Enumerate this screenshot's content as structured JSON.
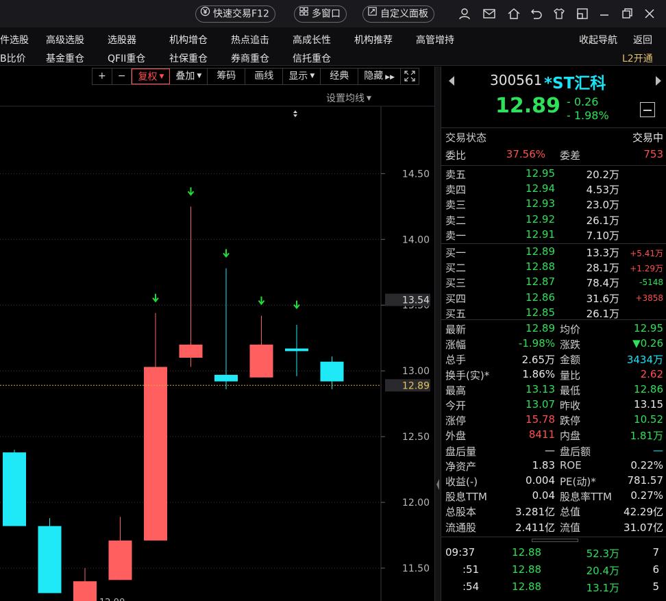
{
  "titlebar": {
    "quick_trade": "快速交易F12",
    "multi_window": "多窗口",
    "custom_panel": "自定义面板"
  },
  "nav": {
    "row1": [
      "件选股",
      "高级选股",
      "选股器",
      "机构增仓",
      "热点追击",
      "高成长性",
      "机构推荐",
      "高管增持"
    ],
    "row2": [
      "B比价",
      "基金重仓",
      "QFII重仓",
      "社保重仓",
      "券商重仓",
      "信托重仓"
    ],
    "collapse": "收起导航",
    "back": "返回",
    "l2": "L2开通"
  },
  "toolbar": {
    "plus": "+",
    "minus": "−",
    "restore": "复权",
    "overlay": "叠加",
    "chips": "筹码",
    "draw": "画线",
    "display": "显示",
    "classic": "经典",
    "hide": "隐藏"
  },
  "chart": {
    "set_ma": "设置均线",
    "ticks": [
      "14.50",
      "14.00",
      "13.50",
      "13.00",
      "12.50",
      "12.00",
      "11.50"
    ],
    "current_price_tag": "12.89",
    "cursor_price_tag": "13.54",
    "bottom_label": "12.00"
  },
  "chart_data": {
    "type": "candlestick",
    "ylim": [
      11.25,
      14.95
    ],
    "candles": [
      {
        "open": 11.82,
        "close": 12.38,
        "high": 12.4,
        "low": 11.82,
        "dir": "down"
      },
      {
        "open": 11.82,
        "close": 11.31,
        "high": 11.88,
        "low": 11.31,
        "dir": "down"
      },
      {
        "open": 11.4,
        "close": 11.2,
        "high": 11.5,
        "low": 11.15,
        "dir": "up"
      },
      {
        "open": 11.41,
        "close": 11.71,
        "high": 11.89,
        "low": 11.41,
        "dir": "up"
      },
      {
        "open": 11.71,
        "close": 13.03,
        "high": 13.44,
        "low": 11.71,
        "dir": "up"
      },
      {
        "open": 13.1,
        "close": 13.2,
        "high": 14.25,
        "low": 13.03,
        "dir": "up"
      },
      {
        "open": 12.92,
        "close": 12.97,
        "high": 13.78,
        "low": 12.86,
        "dir": "down"
      },
      {
        "open": 12.95,
        "close": 13.2,
        "high": 13.42,
        "low": 12.95,
        "dir": "up"
      },
      {
        "open": 13.17,
        "close": 13.15,
        "high": 13.35,
        "low": 12.96,
        "dir": "down"
      },
      {
        "open": 12.92,
        "close": 13.07,
        "high": 13.11,
        "low": 12.86,
        "dir": "down"
      }
    ],
    "markers": [
      4,
      5,
      6,
      7,
      8
    ],
    "current_price": 12.89
  },
  "quote": {
    "code": "300561",
    "name": "*ST汇科",
    "price": "12.89",
    "change": "- 0.26",
    "change_pct": "- 1.98%",
    "status_label": "交易状态",
    "status_value": "交易中",
    "weibi_label": "委比",
    "weibi_value": "37.56%",
    "weicha_label": "委差",
    "weicha_value": "753",
    "asks": [
      {
        "label": "卖五",
        "price": "12.95",
        "vol": "20.2万"
      },
      {
        "label": "卖四",
        "price": "12.94",
        "vol": "4.53万"
      },
      {
        "label": "卖三",
        "price": "12.93",
        "vol": "23.0万"
      },
      {
        "label": "卖二",
        "price": "12.92",
        "vol": "26.1万"
      },
      {
        "label": "卖一",
        "price": "12.91",
        "vol": "7.10万"
      }
    ],
    "bids": [
      {
        "label": "买一",
        "price": "12.89",
        "vol": "13.3万",
        "chg": "+5.41万"
      },
      {
        "label": "买二",
        "price": "12.88",
        "vol": "28.1万",
        "chg": "+1.29万"
      },
      {
        "label": "买三",
        "price": "12.87",
        "vol": "78.4万",
        "chg": "-5148"
      },
      {
        "label": "买四",
        "price": "12.86",
        "vol": "31.6万",
        "chg": "+3858"
      },
      {
        "label": "买五",
        "price": "12.85",
        "vol": "26.1万",
        "chg": ""
      }
    ],
    "stats": [
      {
        "l1": "最新",
        "v1": "12.89",
        "c1": "green",
        "l2": "均价",
        "v2": "12.95",
        "c2": "green"
      },
      {
        "l1": "涨幅",
        "v1": "-1.98%",
        "c1": "green",
        "l2": "涨跌",
        "v2": "▼0.26",
        "c2": "green"
      },
      {
        "l1": "总手",
        "v1": "2.65万",
        "c1": "white",
        "l2": "金额",
        "v2": "3434万",
        "c2": "cyan"
      },
      {
        "l1": "换手(实)*",
        "v1": "1.86%",
        "c1": "white",
        "l2": "量比",
        "v2": "2.62",
        "c2": "red"
      },
      {
        "l1": "最高",
        "v1": "13.13",
        "c1": "green",
        "l2": "最低",
        "v2": "12.86",
        "c2": "green"
      },
      {
        "l1": "今开",
        "v1": "13.07",
        "c1": "green",
        "l2": "昨收",
        "v2": "13.15",
        "c2": "white"
      },
      {
        "l1": "涨停",
        "v1": "15.78",
        "c1": "red",
        "l2": "跌停",
        "v2": "10.52",
        "c2": "green"
      },
      {
        "l1": "外盘",
        "v1": "8411",
        "c1": "red",
        "l2": "内盘",
        "v2": "1.81万",
        "c2": "green"
      },
      {
        "l1": "盘后量",
        "v1": "—",
        "c1": "white",
        "l2": "盘后额",
        "v2": "—",
        "c2": "cyan"
      },
      {
        "l1": "净资产",
        "v1": "1.83",
        "c1": "white",
        "l2": "ROE",
        "v2": "0.22%",
        "c2": "white"
      },
      {
        "l1": "收益(-)",
        "v1": "0.004",
        "c1": "white",
        "l2": "PE(动)*",
        "v2": "781.57",
        "c2": "white"
      },
      {
        "l1": "股息TTM",
        "v1": "0.04",
        "c1": "white",
        "l2": "股息率TTM",
        "v2": "0.27%",
        "c2": "white"
      },
      {
        "l1": "总股本",
        "v1": "3.281亿",
        "c1": "white",
        "l2": "总值",
        "v2": "42.29亿",
        "c2": "white"
      },
      {
        "l1": "流通股",
        "v1": "2.411亿",
        "c1": "white",
        "l2": "流值",
        "v2": "31.07亿",
        "c2": "white"
      }
    ],
    "ticks": [
      {
        "time": "09:37",
        "price": "12.88",
        "vol": "52.3万",
        "n": "7"
      },
      {
        "time": ":51",
        "price": "12.88",
        "vol": "20.4万",
        "n": "6"
      },
      {
        "time": ":54",
        "price": "12.88",
        "vol": "13.1万",
        "n": "5"
      }
    ]
  },
  "colors": {
    "up": "#ff5f5f",
    "down": "#1fe9f7",
    "marker": "#22dd33",
    "grid": "#3a3a3a",
    "price_line": "#d8b23a"
  }
}
